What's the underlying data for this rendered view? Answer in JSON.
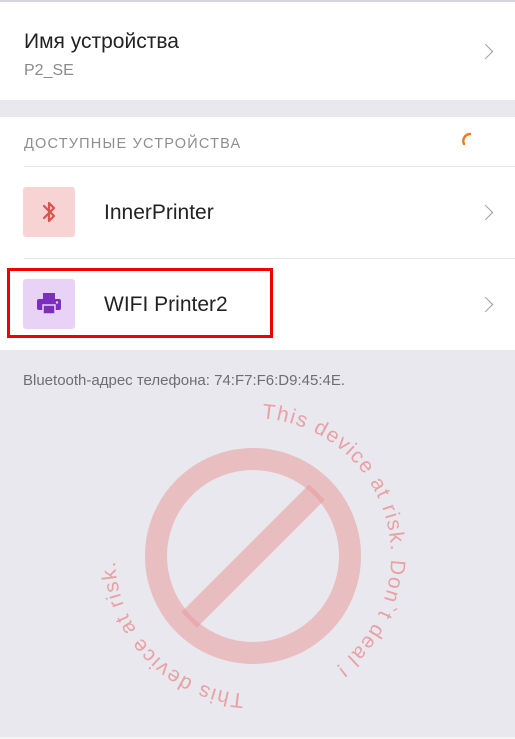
{
  "device_name": {
    "title": "Имя устройства",
    "value": "P2_SE"
  },
  "available_devices": {
    "header": "ДОСТУПНЫЕ УСТРОЙСТВА",
    "items": [
      {
        "label": "InnerPrinter",
        "icon": "bluetooth-icon",
        "icon_bg": "#f8d3d3",
        "icon_color": "#d9534f"
      },
      {
        "label": "WIFI Printer2",
        "icon": "printer-icon",
        "icon_bg": "#e8d3f6",
        "icon_color": "#7b2fbe"
      }
    ]
  },
  "bluetooth_address": "Bluetooth-адрес телефона: 74:F7:F6:D9:45:4E.",
  "watermark": {
    "text": "This device at risk. Don`t deal !",
    "color": "#e89a9c"
  },
  "colors": {
    "accent_spinner": "#f07a1a",
    "highlight_border": "#ee0000",
    "background": "#e9e8ee"
  }
}
